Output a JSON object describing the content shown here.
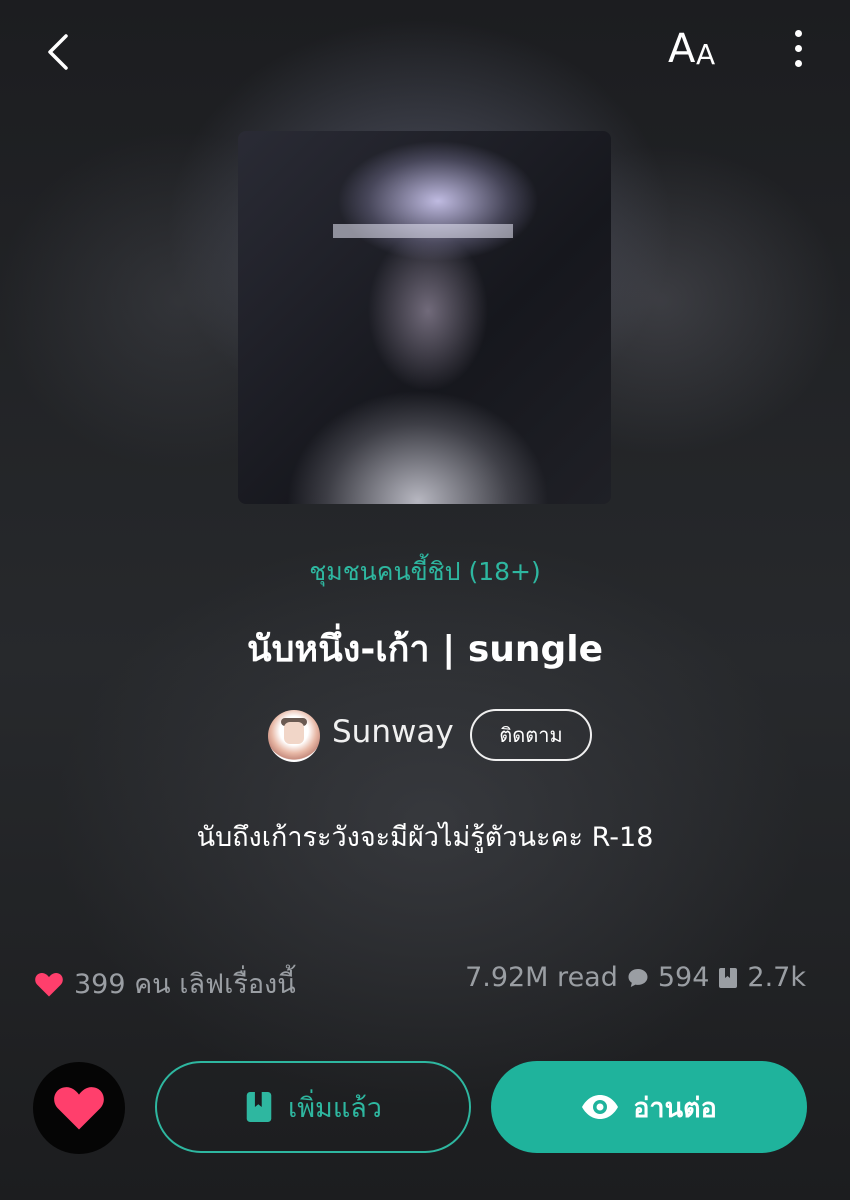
{
  "header": {
    "back_icon": "chevron-left-icon",
    "font_size_big": "A",
    "font_size_small": "A",
    "more_icon": "more-vertical-icon"
  },
  "story": {
    "community": "ชุมชนคนขี้ชิป  (18+)",
    "title": "นับหนึ่ง-เก้า | sungle",
    "author": "Sunway",
    "follow_label": "ติดตาม",
    "description": "นับถึงเก้าระวังจะมีผัวไม่รู้ตัวนะคะ R-18"
  },
  "stats": {
    "likes": "399 คน เลิฟเรื่องนี้",
    "reads": "7.92M read",
    "comments": "594",
    "bookmarks": "2.7k"
  },
  "actions": {
    "added_label": "เพิ่มแล้ว",
    "read_label": "อ่านต่อ"
  },
  "colors": {
    "accent": "#1fb39c",
    "like": "#ff3f6c",
    "background": "#1c1d20"
  }
}
